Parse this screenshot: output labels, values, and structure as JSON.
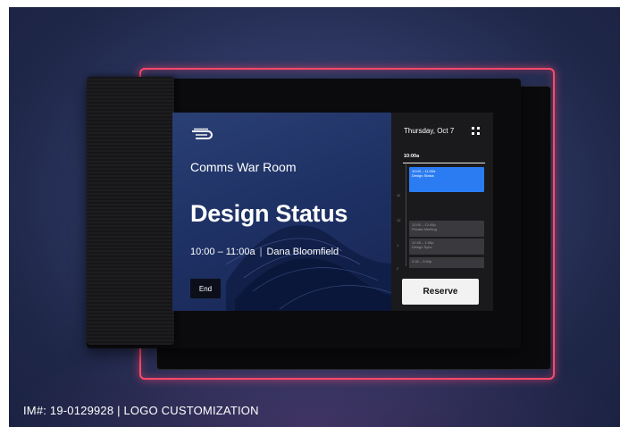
{
  "panel": {
    "room_name": "Comms War Room",
    "meeting_title": "Design Status",
    "meeting_time": "10:00 – 11:00a",
    "separator": "|",
    "organizer": "Dana Bloomfield",
    "end_label": "End"
  },
  "schedule": {
    "date": "Thursday, Oct 7",
    "current_time": "10:00a",
    "hour_ticks": [
      "11",
      "12",
      "1",
      "2"
    ],
    "events": [
      {
        "time": "10:00 – 11:00a",
        "title": "Design Status"
      },
      {
        "time": "12:00 – 12:45p",
        "title": "Private Meeting"
      },
      {
        "time": "12:45 – 1:30p",
        "title": "Design Sync"
      },
      {
        "time": "2:00 – 3:00p",
        "title": ""
      }
    ],
    "reserve_label": "Reserve"
  },
  "caption": {
    "text": "IM#: 19-0129928  |  LOGO CUSTOMIZATION"
  },
  "colors": {
    "accent_event": "#2b7cf2",
    "frame_highlight": "#ff4a6a",
    "background": "#2c3660"
  },
  "icons": {
    "logo": "brand-logo-icon",
    "menu": "grid-dots-icon"
  }
}
